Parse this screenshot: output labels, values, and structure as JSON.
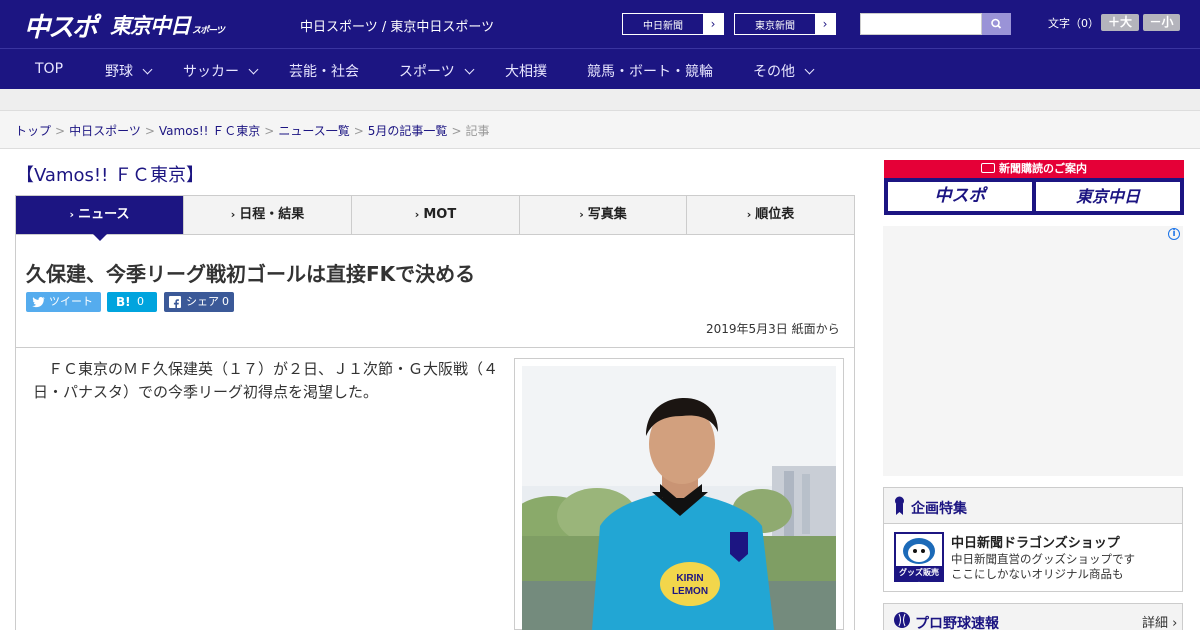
{
  "header": {
    "logo_chuspo": "中スポ",
    "logo_tokyo": "東京中日",
    "logo_tokyo_small": "スポーツ",
    "sites": "中日スポーツ / 東京中日スポーツ",
    "link_chunichi": "中日新聞",
    "link_tokyo": "東京新聞",
    "link_arrow": "›",
    "search_placeholder": "",
    "font_label": "文字（0）",
    "font_larger": "＋大",
    "font_smaller": "－小"
  },
  "nav": {
    "items": [
      {
        "label": "TOP"
      },
      {
        "label": "野球"
      },
      {
        "label": "サッカー"
      },
      {
        "label": "芸能・社会"
      },
      {
        "label": "スポーツ"
      },
      {
        "label": "大相撲"
      },
      {
        "label": "競馬・ボート・競輪"
      },
      {
        "label": "その他"
      }
    ]
  },
  "breadcrumb": {
    "items": [
      "トップ",
      "中日スポーツ",
      "Vamos!! ＦＣ東京",
      "ニュース一覧",
      "5月の記事一覧"
    ],
    "current": "記事",
    "separator": ">"
  },
  "category_title": "【Vamos!! ＦＣ東京】",
  "tabs": {
    "arrow": "›",
    "items": [
      {
        "label": "ニュース"
      },
      {
        "label": "日程・結果"
      },
      {
        "label": "MOT"
      },
      {
        "label": "写真集"
      },
      {
        "label": "順位表"
      }
    ]
  },
  "article": {
    "headline": "久保建、今季リーグ戦初ゴールは直接FKで決める",
    "share": {
      "tweet_label": "ツイート",
      "hatena_label": "B!",
      "hatena_count": "0",
      "facebook_label": "シェア",
      "facebook_count": "0"
    },
    "date": "2019年5月3日 紙面から",
    "body": "ＦＣ東京のＭＦ久保建英（１７）が２日、Ｊ１次節・Ｇ大阪戦（４日・パナスタ）での今季リーグ初得点を渇望した。"
  },
  "sidebar": {
    "subscribe_header": "新聞購読のご案内",
    "subscribe_chuspo": "中スポ",
    "subscribe_tokyo": "東京中日",
    "ad_info": "i",
    "feature_title": "企画特集",
    "shop_title": "中日新聞ドラゴンズショップ",
    "shop_desc_1": "中日新聞直営のグッズショップです",
    "shop_desc_2": "ここにしかないオリジナル商品も",
    "shop_badge": "グッズ販売中",
    "baseball_title": "プロ野球速報",
    "baseball_more": "詳細 ›"
  },
  "colors": {
    "brand": "#1c1582",
    "accent_red": "#e50037",
    "twitter": "#55acee",
    "hatena": "#00a4de",
    "facebook": "#3b5998"
  }
}
